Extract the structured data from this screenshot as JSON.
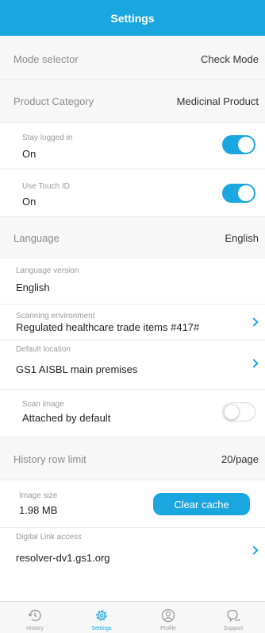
{
  "header": {
    "title": "Settings"
  },
  "mode": {
    "label": "Mode selector",
    "value": "Check Mode"
  },
  "product": {
    "label": "Product Category",
    "value": "Medicinal Product"
  },
  "stay_logged": {
    "label": "Stay logged in",
    "value": "On",
    "enabled": true
  },
  "touch_id": {
    "label": "Use Touch ID",
    "value": "On",
    "enabled": true
  },
  "language": {
    "label": "Language",
    "value": "English"
  },
  "language_version": {
    "label": "Language version",
    "value": "English"
  },
  "scanning_env": {
    "label": "Scanning environment",
    "value": "Regulated healthcare trade items #417#"
  },
  "default_location": {
    "label": "Default location",
    "value": "GS1 AISBL main premises"
  },
  "scan_image": {
    "label": "Scan image",
    "value": "Attached by default",
    "enabled": false
  },
  "history_limit": {
    "label": "History row limit",
    "value": "20/page"
  },
  "image_size": {
    "label": "Image size",
    "value": "1.98 MB",
    "button": "Clear cache"
  },
  "digital_link": {
    "label": "Digital Link access",
    "value": "resolver-dv1.gs1.org"
  },
  "tabs": [
    {
      "label": "History",
      "icon": "history-icon",
      "active": false
    },
    {
      "label": "Settings",
      "icon": "gear-icon",
      "active": true
    },
    {
      "label": "Profile",
      "icon": "profile-icon",
      "active": false
    },
    {
      "label": "Support",
      "icon": "support-icon",
      "active": false
    }
  ],
  "colors": {
    "accent": "#1aa6de",
    "section_bg": "#f7f7f7"
  }
}
